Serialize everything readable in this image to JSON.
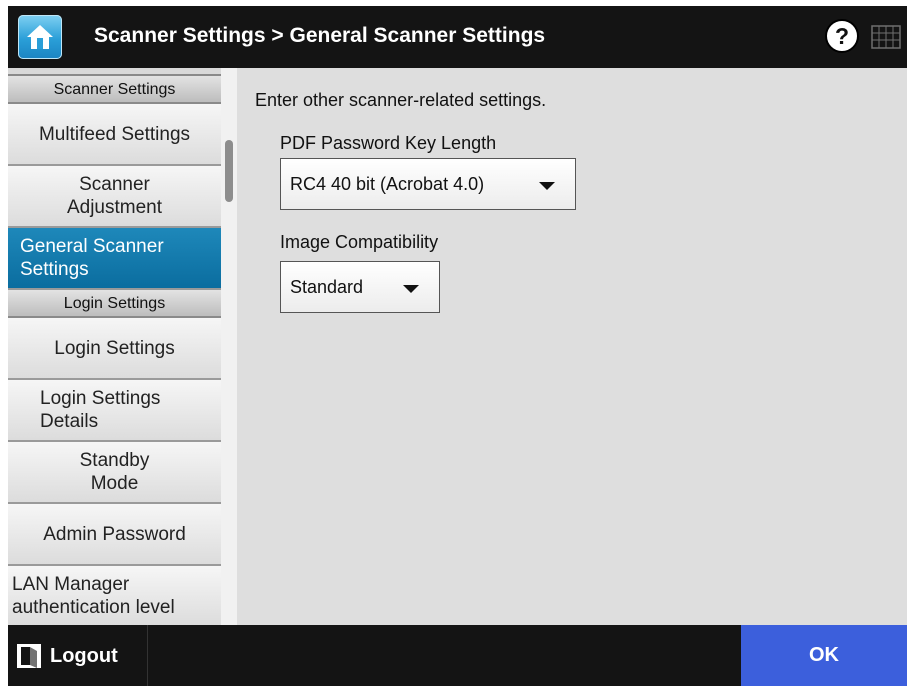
{
  "header": {
    "title": "Scanner Settings > General Scanner Settings",
    "home_icon": "home-icon",
    "help_icon": "help-icon",
    "keyboard_icon": "keyboard-icon"
  },
  "sidebar": {
    "sections": [
      {
        "label": "Scanner Settings",
        "items": [
          {
            "label": "Multifeed Settings",
            "selected": false
          },
          {
            "label": "Scanner Adjustment",
            "selected": false
          },
          {
            "label": "General Scanner Settings",
            "selected": true
          }
        ]
      },
      {
        "label": "Login Settings",
        "items": [
          {
            "label": "Login Settings",
            "selected": false
          },
          {
            "label": "Login Settings Details",
            "selected": false
          },
          {
            "label": "Standby Mode",
            "selected": false
          },
          {
            "label": "Admin Password",
            "selected": false
          },
          {
            "label": "LAN Manager authentication level",
            "selected": false
          }
        ]
      }
    ]
  },
  "main": {
    "description": "Enter other scanner-related settings.",
    "pdf_key_length": {
      "label": "PDF Password Key Length",
      "value": "RC4 40 bit (Acrobat 4.0)"
    },
    "image_compat": {
      "label": "Image Compatibility",
      "value": "Standard"
    }
  },
  "footer": {
    "logout_label": "Logout",
    "ok_label": "OK"
  },
  "colors": {
    "selected_item": "#0b6d9f",
    "ok_button": "#3c5fdc",
    "header_bg": "#141414",
    "content_bg": "#dedede"
  }
}
